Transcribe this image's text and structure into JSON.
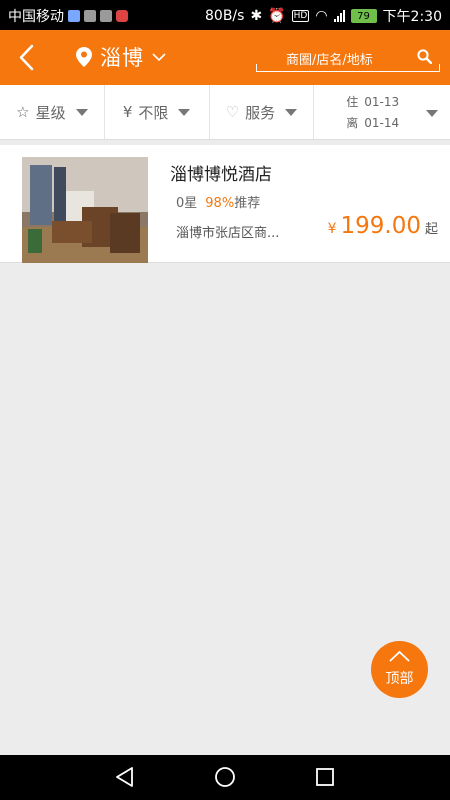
{
  "status_bar": {
    "carrier": "中国移动",
    "speed": "80B/s",
    "battery": "79",
    "time": "下午2:30"
  },
  "header": {
    "city": "淄博",
    "search_placeholder": "商圈/店名/地标",
    "accent_color": "#f5770e"
  },
  "filters": {
    "star_label": "星级",
    "price_label": "不限",
    "price_symbol": "¥",
    "service_label": "服务",
    "checkin_prefix": "住",
    "checkin_date": "01-13",
    "checkout_prefix": "离",
    "checkout_date": "01-14"
  },
  "hotels": [
    {
      "name": "淄博博悦酒店",
      "star": "0星",
      "rating": "98%",
      "recommend": "推荐",
      "address": "淄博市张店区商...",
      "currency": "¥",
      "price": "199.00",
      "price_suffix": "起"
    }
  ],
  "to_top_label": "顶部"
}
